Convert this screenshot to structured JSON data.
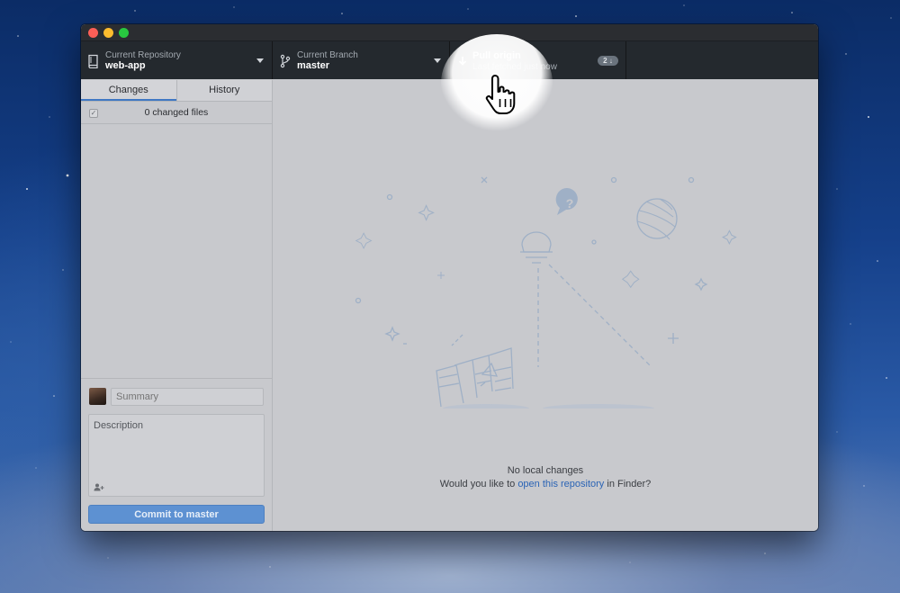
{
  "window": {
    "toolbar": {
      "repository": {
        "label": "Current Repository",
        "value": "web-app"
      },
      "branch": {
        "label": "Current Branch",
        "value": "master"
      },
      "pull": {
        "label": "Pull origin",
        "subtitle": "Last fetched just now",
        "badge": "2"
      }
    },
    "sidebar": {
      "tabs": [
        {
          "label": "Changes",
          "active": true
        },
        {
          "label": "History",
          "active": false
        }
      ],
      "files_header": "0 changed files",
      "commit": {
        "summary_placeholder": "Summary",
        "description_placeholder": "Description",
        "button_label": "Commit to master"
      }
    },
    "main": {
      "heading": "No local changes",
      "prompt_prefix": "Would you like to ",
      "prompt_link": "open this repository",
      "prompt_suffix": " in Finder?"
    }
  },
  "colors": {
    "toolbar_bg": "#24292e",
    "accent": "#3f78c4",
    "commit_button": "#5d91d2",
    "link": "#2b64b5"
  }
}
